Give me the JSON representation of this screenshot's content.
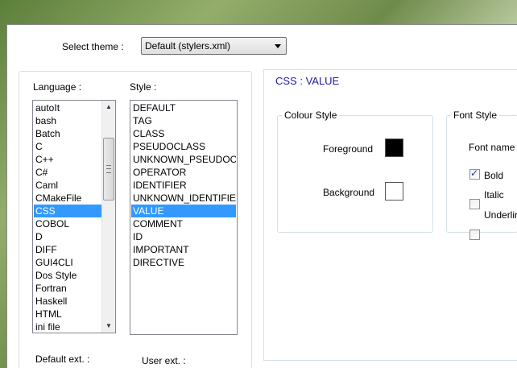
{
  "theme": {
    "label": "Select theme :",
    "selected": "Default (stylers.xml)"
  },
  "language": {
    "label": "Language :",
    "items": [
      "autoIt",
      "bash",
      "Batch",
      "C",
      "C++",
      "C#",
      "Caml",
      "CMakeFile",
      "CSS",
      "COBOL",
      "D",
      "DIFF",
      "GUI4CLI",
      "Dos Style",
      "Fortran",
      "Haskell",
      "HTML",
      "ini file"
    ],
    "selected_index": 8
  },
  "style": {
    "label": "Style :",
    "items": [
      "DEFAULT",
      "TAG",
      "CLASS",
      "PSEUDOCLASS",
      "UNKNOWN_PSEUDOCLASS",
      "OPERATOR",
      "IDENTIFIER",
      "UNKNOWN_IDENTIFIER",
      "VALUE",
      "COMMENT",
      "ID",
      "IMPORTANT",
      "DIRECTIVE"
    ],
    "selected_index": 8
  },
  "header": {
    "title": "CSS : VALUE",
    "title_color": "#1a1aa6"
  },
  "colour_style": {
    "legend": "Colour Style",
    "foreground_label": "Foreground",
    "foreground_color": "#000000",
    "background_label": "Background",
    "background_color": "#ffffff"
  },
  "font_style": {
    "legend": "Font Style",
    "font_name_label": "Font name",
    "bold_label": "Bold",
    "bold_checked": true,
    "italic_label": "Italic",
    "italic_checked": false,
    "underline_label": "Underlir",
    "underline_checked": false
  },
  "ext": {
    "default_label": "Default ext. :",
    "user_label": "User ext. :"
  },
  "colors": {
    "selection": "#3399ff",
    "accent_text": "#1a1aa6"
  }
}
